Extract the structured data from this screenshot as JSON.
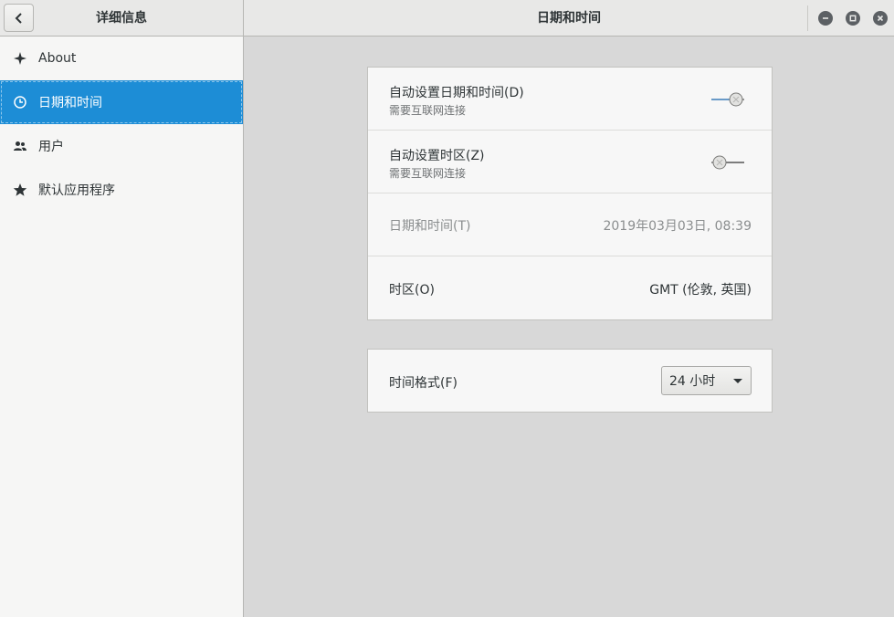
{
  "left_header": {
    "title": "详细信息",
    "back_icon": "chevron-left-icon"
  },
  "sidebar": {
    "items": [
      {
        "label": "About",
        "icon": "sparkle-icon",
        "active": false
      },
      {
        "label": "日期和时间",
        "icon": "clock-icon",
        "active": true
      },
      {
        "label": "用户",
        "icon": "users-icon",
        "active": false
      },
      {
        "label": "默认应用程序",
        "icon": "star-icon",
        "active": false
      }
    ]
  },
  "header": {
    "title": "日期和时间",
    "window_controls": [
      "minimize-icon",
      "maximize-icon",
      "close-icon"
    ]
  },
  "datetime_card": {
    "auto_datetime": {
      "title": "自动设置日期和时间(D)",
      "subtitle": "需要互联网连接",
      "enabled": true
    },
    "auto_timezone": {
      "title": "自动设置时区(Z)",
      "subtitle": "需要互联网连接",
      "enabled": false
    },
    "date_time": {
      "label": "日期和时间(T)",
      "value": "2019年03月03日, 08:39"
    },
    "timezone": {
      "label": "时区(O)",
      "value": "GMT (伦敦, 英国)"
    }
  },
  "format_card": {
    "time_format": {
      "label": "时间格式(F)",
      "value": "24 小时"
    }
  },
  "colors": {
    "accent": "#1d8dd6",
    "sidebar_bg": "#f6f6f5",
    "content_bg": "#d8d8d8"
  }
}
